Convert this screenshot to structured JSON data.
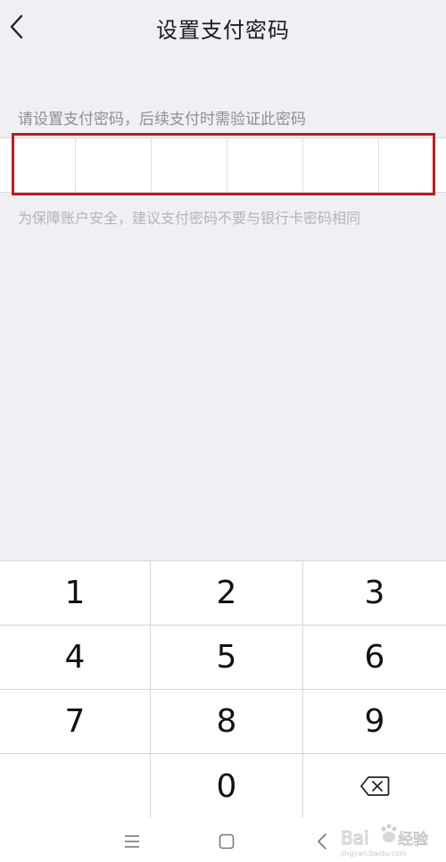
{
  "header": {
    "title": "设置支付密码",
    "back_icon": "chevron-left-icon"
  },
  "pin": {
    "prompt": "请设置支付密码，后续支付时需验证此密码",
    "digits": [
      "",
      "",
      "",
      "",
      "",
      ""
    ],
    "hint": "为保障账户安全，建议支付密码不要与银行卡密码相同",
    "highlight_color": "#c8161d"
  },
  "keypad": {
    "keys": [
      "1",
      "2",
      "3",
      "4",
      "5",
      "6",
      "7",
      "8",
      "9",
      "",
      "0",
      ""
    ],
    "delete_icon": "backspace-icon"
  },
  "system_nav": {
    "icons": [
      "menu-icon",
      "home-icon",
      "back-icon"
    ]
  },
  "watermark": {
    "text": "Bai 经验",
    "sub": "jingyan.baidu.com"
  }
}
